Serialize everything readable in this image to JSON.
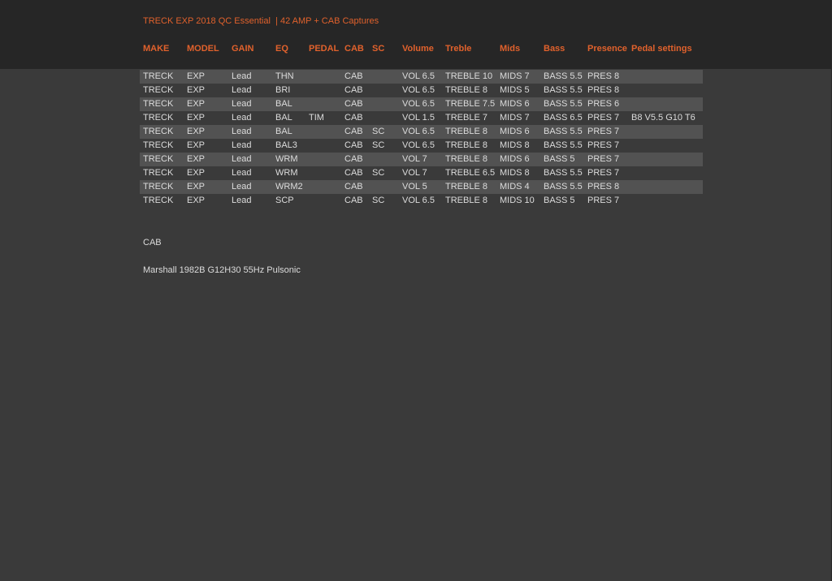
{
  "document": {
    "title": "TRECK EXP 2018 QC Essential  | 42 AMP + CAB Captures"
  },
  "table": {
    "headers": {
      "make": "MAKE",
      "model": "MODEL",
      "gain": "GAIN",
      "eq": "EQ",
      "pedal": "PEDAL",
      "cab": "CAB",
      "sc": "SC",
      "volume": "Volume",
      "treble": "Treble",
      "mids": "Mids",
      "bass": "Bass",
      "presence": "Presence",
      "pedal_settings": "Pedal settings"
    },
    "rows": [
      {
        "make": "TRECK",
        "model": "EXP",
        "gain": "Lead",
        "eq": "THN",
        "pedal": "",
        "cab": "CAB",
        "sc": "",
        "volume": "VOL 6.5",
        "treble": "TREBLE 10",
        "mids": "MIDS 7",
        "bass": "BASS 5.5",
        "presence": "PRES 8",
        "pedal_settings": ""
      },
      {
        "make": "TRECK",
        "model": "EXP",
        "gain": "Lead",
        "eq": "BRI",
        "pedal": "",
        "cab": "CAB",
        "sc": "",
        "volume": "VOL 6.5",
        "treble": "TREBLE 8",
        "mids": "MIDS 5",
        "bass": "BASS 5.5",
        "presence": "PRES 8",
        "pedal_settings": ""
      },
      {
        "make": "TRECK",
        "model": "EXP",
        "gain": "Lead",
        "eq": "BAL",
        "pedal": "",
        "cab": "CAB",
        "sc": "",
        "volume": "VOL 6.5",
        "treble": "TREBLE 7.5",
        "mids": "MIDS 6",
        "bass": "BASS 5.5",
        "presence": "PRES 6",
        "pedal_settings": ""
      },
      {
        "make": "TRECK",
        "model": "EXP",
        "gain": "Lead",
        "eq": "BAL",
        "pedal": "TIM",
        "cab": "CAB",
        "sc": "",
        "volume": "VOL 1.5",
        "treble": "TREBLE 7",
        "mids": "MIDS 7",
        "bass": "BASS 6.5",
        "presence": "PRES 7",
        "pedal_settings": "B8 V5.5 G10 T6"
      },
      {
        "make": "TRECK",
        "model": "EXP",
        "gain": "Lead",
        "eq": "BAL",
        "pedal": "",
        "cab": "CAB",
        "sc": "SC",
        "volume": "VOL 6.5",
        "treble": "TREBLE 8",
        "mids": "MIDS 6",
        "bass": "BASS 5.5",
        "presence": "PRES 7",
        "pedal_settings": ""
      },
      {
        "make": "TRECK",
        "model": "EXP",
        "gain": "Lead",
        "eq": "BAL3",
        "pedal": "",
        "cab": "CAB",
        "sc": "SC",
        "volume": "VOL 6.5",
        "treble": "TREBLE 8",
        "mids": "MIDS 8",
        "bass": "BASS 5.5",
        "presence": "PRES 7",
        "pedal_settings": ""
      },
      {
        "make": "TRECK",
        "model": "EXP",
        "gain": "Lead",
        "eq": "WRM",
        "pedal": "",
        "cab": "CAB",
        "sc": "",
        "volume": "VOL 7",
        "treble": "TREBLE 8",
        "mids": "MIDS 6",
        "bass": "BASS 5",
        "presence": "PRES 7",
        "pedal_settings": ""
      },
      {
        "make": "TRECK",
        "model": "EXP",
        "gain": "Lead",
        "eq": "WRM",
        "pedal": "",
        "cab": "CAB",
        "sc": "SC",
        "volume": "VOL 7",
        "treble": "TREBLE 6.5",
        "mids": "MIDS 8",
        "bass": "BASS 5.5",
        "presence": "PRES 7",
        "pedal_settings": ""
      },
      {
        "make": "TRECK",
        "model": "EXP",
        "gain": "Lead",
        "eq": "WRM2",
        "pedal": "",
        "cab": "CAB",
        "sc": "",
        "volume": "VOL 5",
        "treble": "TREBLE 8",
        "mids": "MIDS 4",
        "bass": "BASS 5.5",
        "presence": "PRES 8",
        "pedal_settings": ""
      },
      {
        "make": "TRECK",
        "model": "EXP",
        "gain": "Lead",
        "eq": "SCP",
        "pedal": "",
        "cab": "CAB",
        "sc": "SC",
        "volume": "VOL 6.5",
        "treble": "TREBLE 8",
        "mids": "MIDS 10",
        "bass": "BASS 5",
        "presence": "PRES 7",
        "pedal_settings": ""
      }
    ]
  },
  "cab_section": {
    "label": "CAB",
    "value": "Marshall 1982B G12H30 55Hz Pulsonic"
  },
  "colors": {
    "accent": "#e0612c",
    "background": "#3a3a3a",
    "header_band": "#262626",
    "row_shade": "#525252",
    "text": "#dcdcdc"
  }
}
